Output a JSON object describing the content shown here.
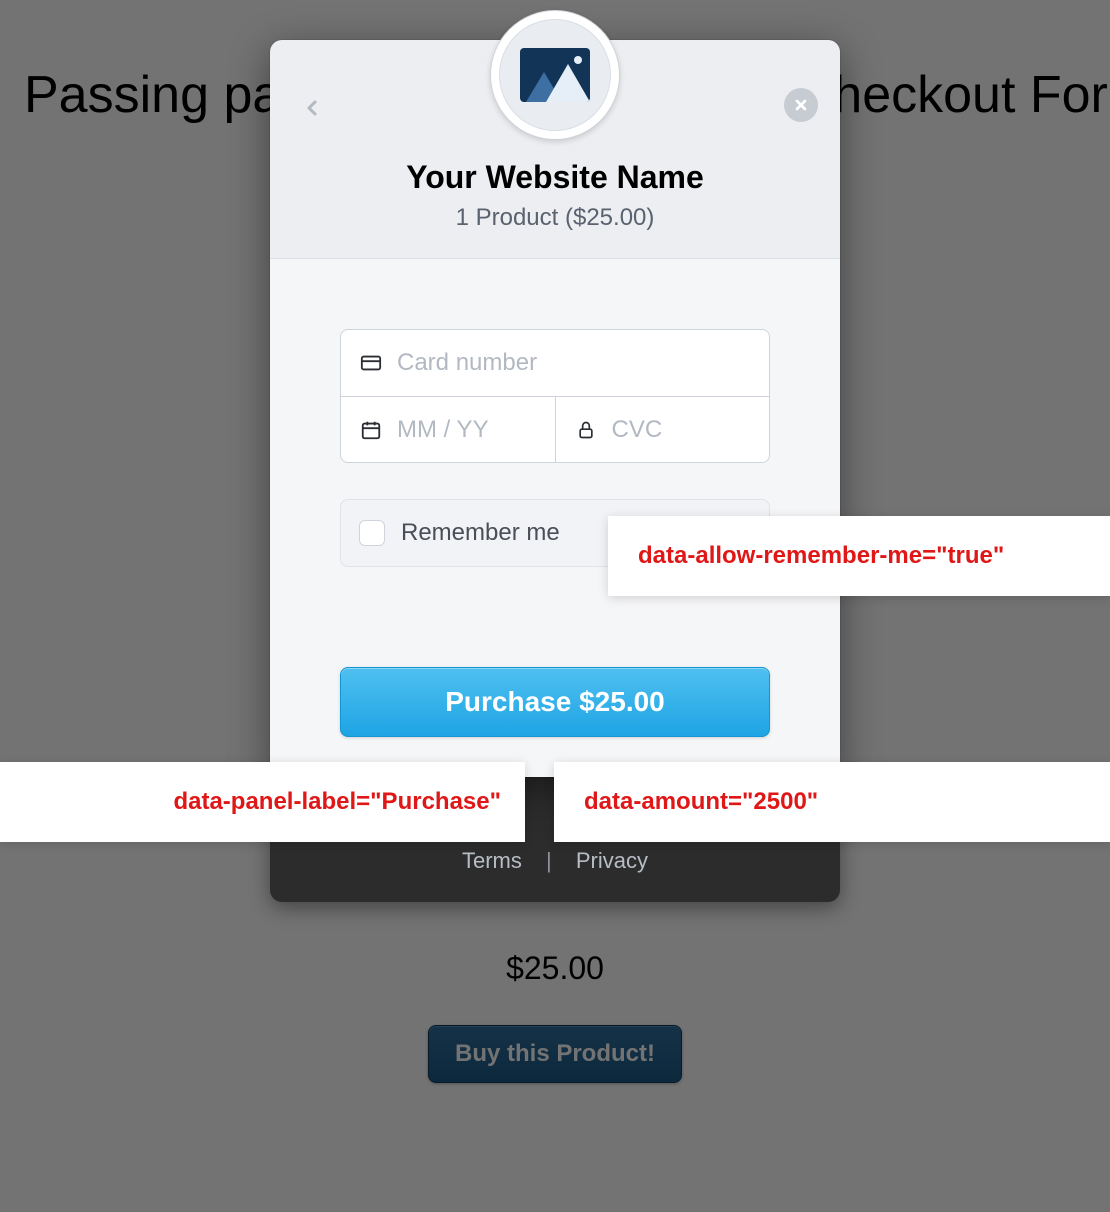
{
  "page": {
    "title": "Passing parameters to the Stripe Checkout Form",
    "price": "$25.00",
    "buy_button": "Buy this Product!"
  },
  "modal": {
    "header": {
      "title": "Your Website Name",
      "subtitle": "1 Product ($25.00)"
    },
    "fields": {
      "card_placeholder": "Card number",
      "exp_placeholder": "MM / YY",
      "cvc_placeholder": "CVC"
    },
    "remember_label": "Remember me",
    "pay_button": "Purchase $25.00",
    "footer": {
      "terms": "Terms",
      "privacy": "Privacy"
    }
  },
  "annotations": {
    "remember": "data-allow-remember-me=\"true\"",
    "panel_label": "data-panel-label=\"Purchase\"",
    "amount": "data-amount=\"2500\""
  }
}
